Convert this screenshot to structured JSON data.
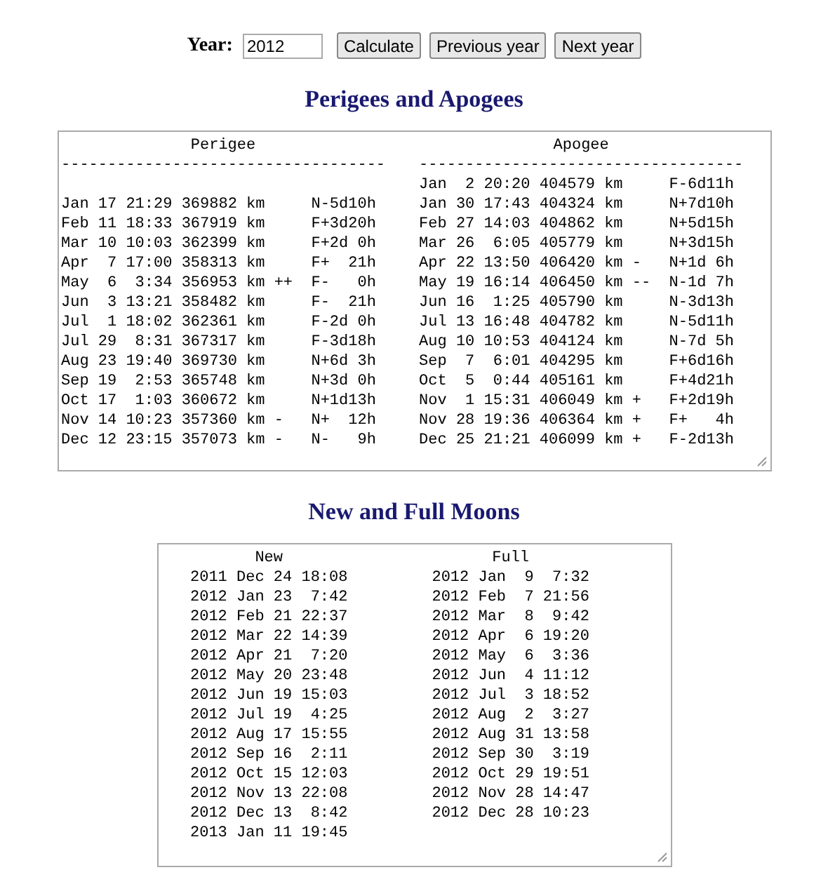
{
  "year_form": {
    "label": "Year:",
    "value": "2012",
    "buttons": [
      "Calculate",
      "Previous year",
      "Next year"
    ]
  },
  "perigees_apogees": {
    "title": "Perigees and Apogees",
    "columns": [
      {
        "header": "Perigee",
        "rule": "-----------------------------------",
        "rows": [
          "Jan 17 21:29 369882 km     N-5d10h",
          "Feb 11 18:33 367919 km     F+3d20h",
          "Mar 10 10:03 362399 km     F+2d 0h",
          "Apr  7 17:00 358313 km     F+  21h",
          "May  6  3:34 356953 km ++  F-   0h",
          "Jun  3 13:21 358482 km     F-  21h",
          "Jul  1 18:02 362361 km     F-2d 0h",
          "Jul 29  8:31 367317 km     F-3d18h",
          "Aug 23 19:40 369730 km     N+6d 3h",
          "Sep 19  2:53 365748 km     N+3d 0h",
          "Oct 17  1:03 360672 km     N+1d13h",
          "Nov 14 10:23 357360 km -   N+  12h",
          "Dec 12 23:15 357073 km -   N-   9h"
        ]
      },
      {
        "header": "Apogee",
        "rule": "-----------------------------------",
        "rows": [
          "Jan  2 20:20 404579 km     F-6d11h",
          "Jan 30 17:43 404324 km     N+7d10h",
          "Feb 27 14:03 404862 km     N+5d15h",
          "Mar 26  6:05 405779 km     N+3d15h",
          "Apr 22 13:50 406420 km -   N+1d 6h",
          "May 19 16:14 406450 km --  N-1d 7h",
          "Jun 16  1:25 405790 km     N-3d13h",
          "Jul 13 16:48 404782 km     N-5d11h",
          "Aug 10 10:53 404124 km     N-7d 5h",
          "Sep  7  6:01 404295 km     F+6d16h",
          "Oct  5  0:44 405161 km     F+4d21h",
          "Nov  1 15:31 406049 km +   F+2d19h",
          "Nov 28 19:36 406364 km +   F+   4h",
          "Dec 25 21:21 406099 km +   F-2d13h"
        ]
      }
    ]
  },
  "new_full_moons": {
    "title": "New and Full Moons",
    "columns": [
      {
        "header": "New",
        "rows": [
          "2011 Dec 24 18:08",
          "2012 Jan 23  7:42",
          "2012 Feb 21 22:37",
          "2012 Mar 22 14:39",
          "2012 Apr 21  7:20",
          "2012 May 20 23:48",
          "2012 Jun 19 15:03",
          "2012 Jul 19  4:25",
          "2012 Aug 17 15:55",
          "2012 Sep 16  2:11",
          "2012 Oct 15 12:03",
          "2012 Nov 13 22:08",
          "2012 Dec 13  8:42",
          "2013 Jan 11 19:45"
        ]
      },
      {
        "header": "Full",
        "rows": [
          "2012 Jan  9  7:32",
          "2012 Feb  7 21:56",
          "2012 Mar  8  9:42",
          "2012 Apr  6 19:20",
          "2012 May  6  3:36",
          "2012 Jun  4 11:12",
          "2012 Jul  3 18:52",
          "2012 Aug  2  3:27",
          "2012 Aug 31 13:58",
          "2012 Sep 30  3:19",
          "2012 Oct 29 19:51",
          "2012 Nov 28 14:47",
          "2012 Dec 28 10:23"
        ]
      }
    ]
  }
}
